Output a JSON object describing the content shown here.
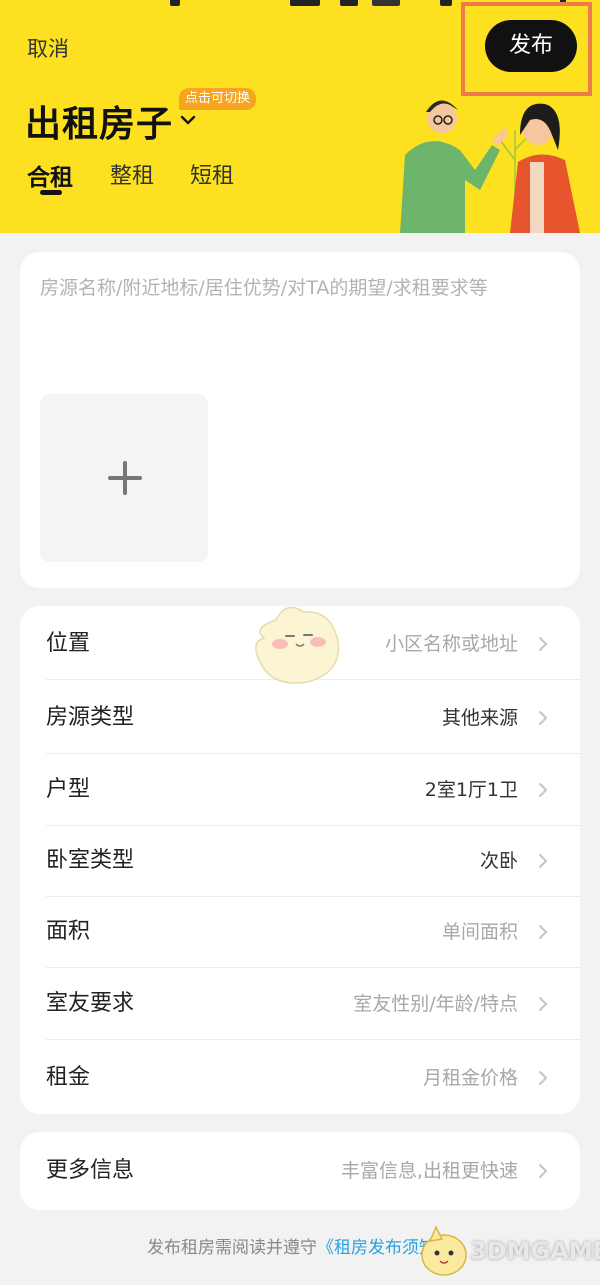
{
  "header": {
    "cancel_label": "取消",
    "publish_label": "发布",
    "title": "出租房子",
    "switch_badge": "点击可切换",
    "tabs": [
      {
        "label": "合租",
        "active": true
      },
      {
        "label": "整租",
        "active": false
      },
      {
        "label": "短租",
        "active": false
      }
    ],
    "bg_color": "#fde121"
  },
  "description": {
    "placeholder": "房源名称/附近地标/居住优势/对TA的期望/求租要求等",
    "add_photo_icon": "plus-icon"
  },
  "form": {
    "rows": [
      {
        "label": "位置",
        "value": "小区名称或地址",
        "is_placeholder": true
      },
      {
        "label": "房源类型",
        "value": "其他来源",
        "is_placeholder": false
      },
      {
        "label": "户型",
        "value": "2室1厅1卫",
        "is_placeholder": false
      },
      {
        "label": "卧室类型",
        "value": "次卧",
        "is_placeholder": false
      },
      {
        "label": "面积",
        "value": "单间面积",
        "is_placeholder": true
      },
      {
        "label": "室友要求",
        "value": "室友性别/年龄/特点",
        "is_placeholder": true
      },
      {
        "label": "租金",
        "value": "月租金价格",
        "is_placeholder": true
      }
    ]
  },
  "more": {
    "label": "更多信息",
    "value": "丰富信息,出租更快速"
  },
  "footer": {
    "prefix": "发布租房需阅读并遵守",
    "link": "《租房发布须知》"
  },
  "watermark": "3DMGAME",
  "colors": {
    "accent": "#fde121",
    "highlight_frame": "#ee7b4a",
    "link": "#29a3e0",
    "badge": "#f7a51e"
  }
}
